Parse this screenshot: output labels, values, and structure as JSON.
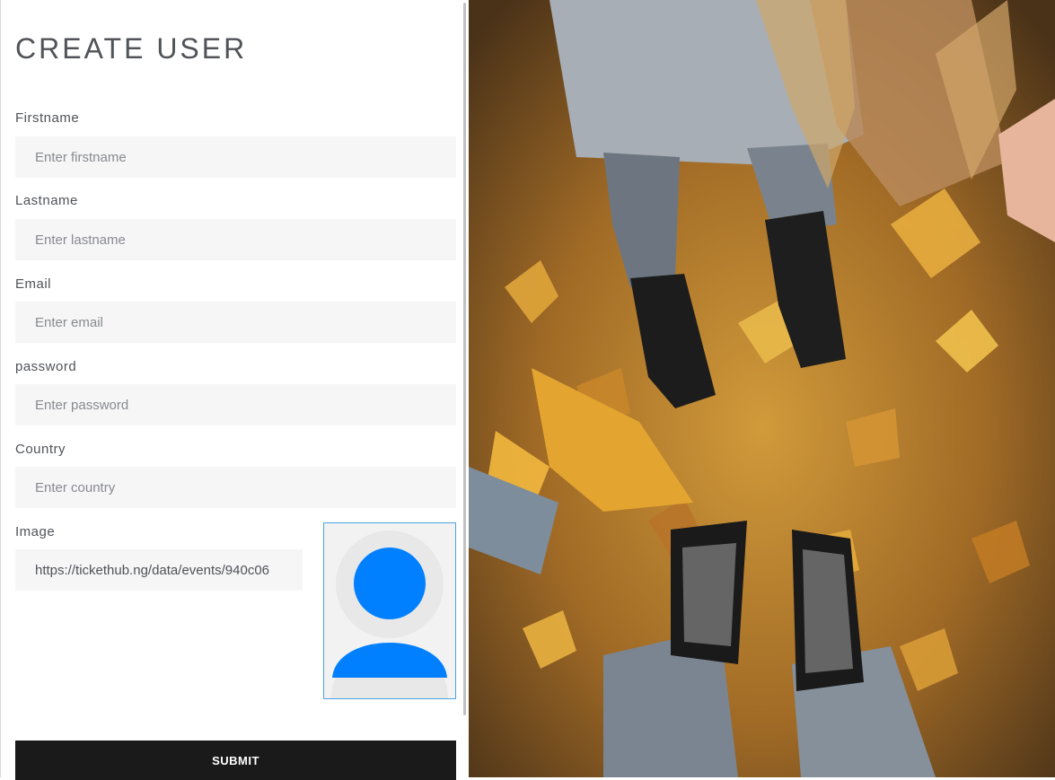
{
  "form": {
    "title": "CREATE USER",
    "fields": [
      {
        "label": "Firstname",
        "placeholder": "Enter firstname",
        "value": ""
      },
      {
        "label": "Lastname",
        "placeholder": "Enter lastname",
        "value": ""
      },
      {
        "label": "Email",
        "placeholder": "Enter email",
        "value": ""
      },
      {
        "label": "password",
        "placeholder": "Enter password",
        "value": ""
      },
      {
        "label": "Country",
        "placeholder": "Enter country",
        "value": ""
      }
    ],
    "image": {
      "label": "Image",
      "value": "https://tickethub.ng/data/events/940c06"
    },
    "preview_icon": "user-avatar-icon",
    "submit_label": "SUBMIT"
  },
  "colors": {
    "avatar": "#0080ff",
    "submit_bg": "#1a1a1a",
    "input_bg": "#f6f6f7",
    "preview_border": "#4aa3df"
  },
  "photo": {
    "description_icon": "autumn-leaves-sneakers-photo"
  }
}
